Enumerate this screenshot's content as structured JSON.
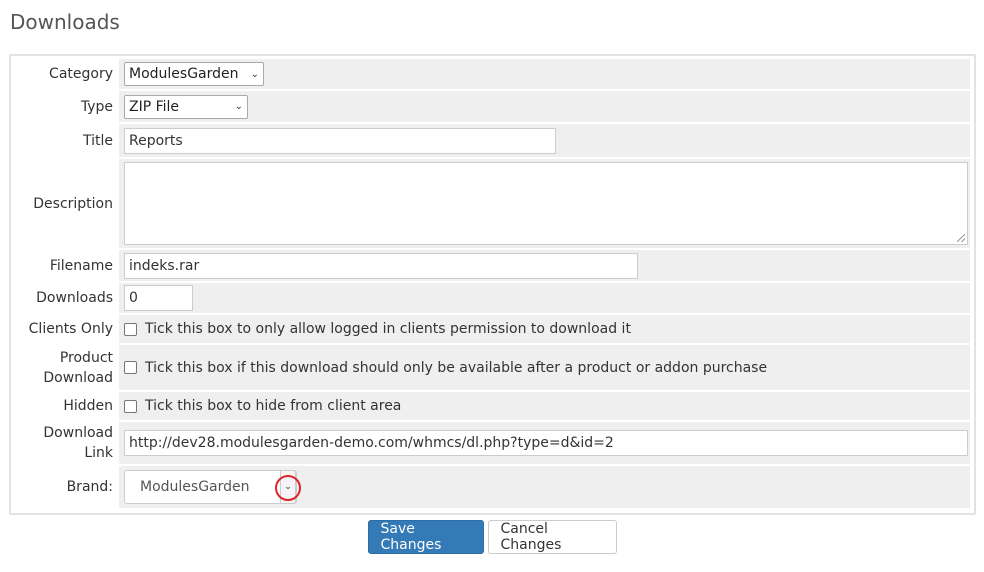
{
  "page": {
    "title": "Downloads"
  },
  "form": {
    "category": {
      "label": "Category",
      "value": "ModulesGarden"
    },
    "type": {
      "label": "Type",
      "value": "ZIP File"
    },
    "title": {
      "label": "Title",
      "value": "Reports"
    },
    "description": {
      "label": "Description",
      "value": ""
    },
    "filename": {
      "label": "Filename",
      "value": "indeks.rar"
    },
    "downloads": {
      "label": "Downloads",
      "value": "0"
    },
    "clients_only": {
      "label": "Clients Only",
      "text": "Tick this box to only allow logged in clients permission to download it",
      "checked": false
    },
    "product_download": {
      "label_line1": "Product",
      "label_line2": "Download",
      "text": "Tick this box if this download should only be available after a product or addon purchase",
      "checked": false
    },
    "hidden": {
      "label": "Hidden",
      "text": "Tick this box to hide from client area",
      "checked": false
    },
    "download_link": {
      "label_line1": "Download",
      "label_line2": "Link",
      "value": "http://dev28.modulesgarden-demo.com/whmcs/dl.php?type=d&id=2"
    },
    "brand": {
      "label": "Brand:",
      "value": "ModulesGarden"
    }
  },
  "actions": {
    "save_label": "Save Changes",
    "cancel_label": "Cancel Changes"
  },
  "colors": {
    "primary": "#337ab7",
    "row_bg": "#efefef",
    "highlight": "#d9262e"
  },
  "icons": {
    "select_arrow": "chevron-down-icon",
    "textarea_resize": "resize-grip-icon"
  }
}
